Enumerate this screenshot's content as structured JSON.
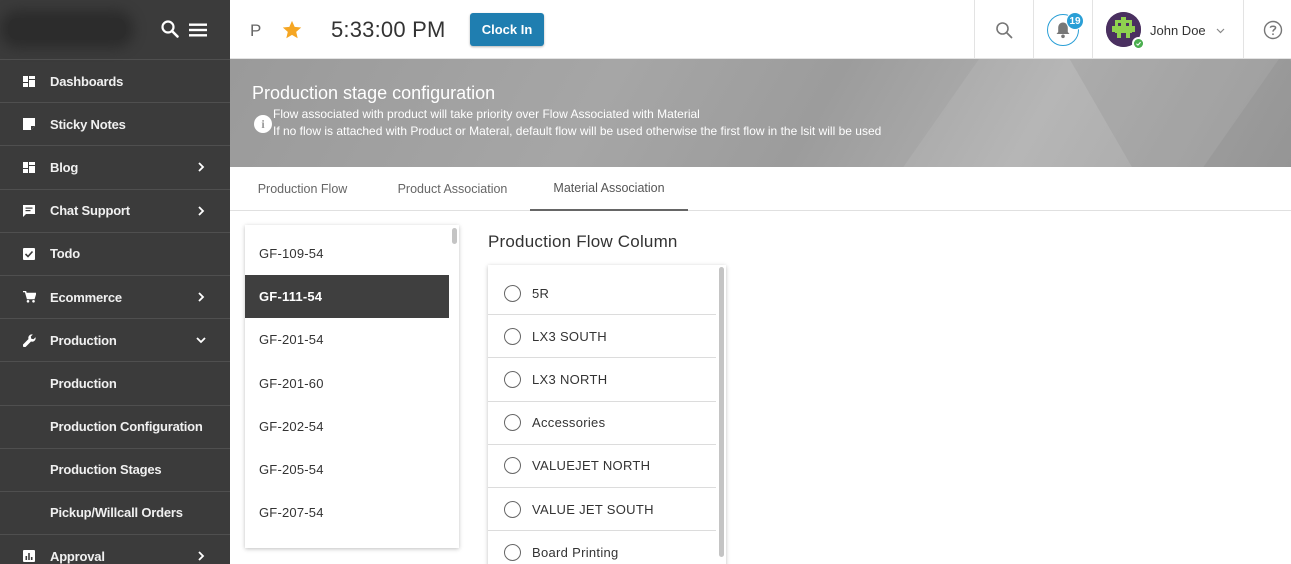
{
  "sidebar": {
    "items": [
      {
        "label": "Dashboards",
        "icon": "dashboard-icon",
        "has_arrow": false
      },
      {
        "label": "Sticky Notes",
        "icon": "sticky-note-icon",
        "has_arrow": false
      },
      {
        "label": "Blog",
        "icon": "dashboard-icon",
        "has_arrow": true
      },
      {
        "label": "Chat Support",
        "icon": "chat-icon",
        "has_arrow": true
      },
      {
        "label": "Todo",
        "icon": "checkbox-icon",
        "has_arrow": false
      },
      {
        "label": "Ecommerce",
        "icon": "cart-icon",
        "has_arrow": true
      },
      {
        "label": "Production",
        "icon": "wrench-icon",
        "expanded": true
      },
      {
        "label": "Production"
      },
      {
        "label": "Production Configuration"
      },
      {
        "label": "Production Stages"
      },
      {
        "label": "Pickup/Willcall Orders"
      },
      {
        "label": "Approval",
        "icon": "chart-icon",
        "has_arrow": true
      }
    ]
  },
  "topbar": {
    "initial": "P",
    "time": "5:33:00 PM",
    "clock_in_label": "Clock In",
    "notification_count": "19",
    "user_name": "John Doe"
  },
  "banner": {
    "title": "Production stage configuration",
    "line1": "Flow associated with product will take priority over Flow Associated with Material",
    "line2": "If no flow is attached with Product or Materal, default flow will be used otherwise the first flow in the lsit will be used"
  },
  "tabs": [
    {
      "label": "Production Flow"
    },
    {
      "label": "Product Association"
    },
    {
      "label": "Material Association",
      "active": true
    }
  ],
  "materials": {
    "items": [
      "GF-109-54",
      "GF-111-54",
      "GF-201-54",
      "GF-201-60",
      "GF-202-54",
      "GF-205-54",
      "GF-207-54"
    ],
    "selected": "GF-111-54"
  },
  "flow_column": {
    "title": "Production Flow Column",
    "options": [
      "5R",
      "LX3 SOUTH",
      "LX3 NORTH",
      "Accessories",
      "VALUEJET NORTH",
      "VALUE JET SOUTH",
      "Board Printing"
    ]
  },
  "colors": {
    "sidebar_bg": "#3b3b3b",
    "accent_button": "#1f7eb0",
    "badge": "#2a9fd6",
    "star": "#f5a623",
    "selected_row": "#3f3f3f",
    "online_status": "#4caf50"
  }
}
